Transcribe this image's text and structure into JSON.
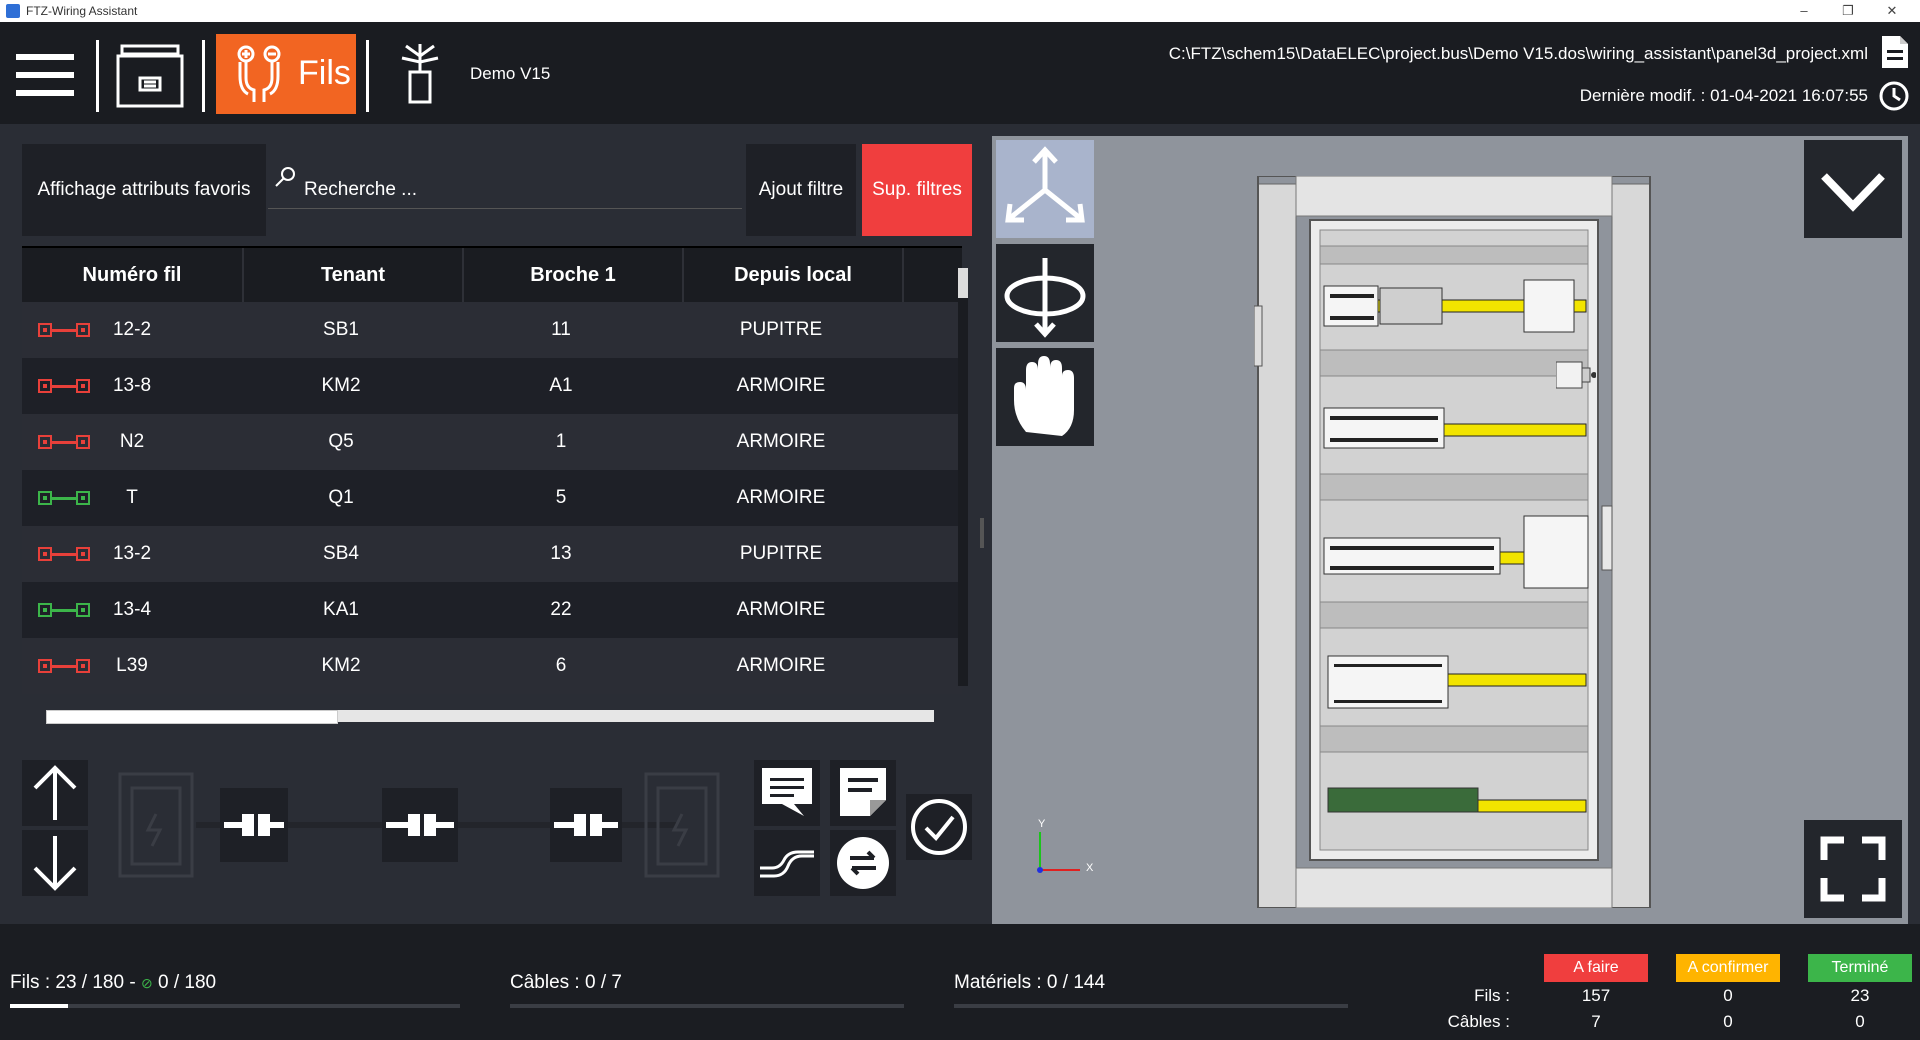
{
  "window": {
    "title": "FTZ-Wiring Assistant",
    "minimize": "–",
    "restore": "❐",
    "close": "✕"
  },
  "toolbar": {
    "fils_label": "Fils",
    "project_name": "Demo V15",
    "path": "C:\\FTZ\\schem15\\DataELEC\\project.bus\\Demo V15.dos\\wiring_assistant\\panel3d_project.xml",
    "last_modified": "Dernière modif. : 01-04-2021 16:07:55"
  },
  "filters": {
    "favorites_label": "Affichage attributs favoris",
    "search_placeholder": "Recherche ...",
    "add_filter_label": "Ajout filtre",
    "remove_filters_label": "Sup. filtres"
  },
  "table": {
    "columns": [
      "Numéro fil",
      "Tenant",
      "Broche 1",
      "Depuis local"
    ],
    "rows": [
      {
        "status": "red",
        "wire": "12-2",
        "tenant": "SB1",
        "broche": "11",
        "local": "PUPITRE"
      },
      {
        "status": "red",
        "wire": "13-8",
        "tenant": "KM2",
        "broche": "A1",
        "local": "ARMOIRE"
      },
      {
        "status": "red",
        "wire": "N2",
        "tenant": "Q5",
        "broche": "1",
        "local": "ARMOIRE"
      },
      {
        "status": "green",
        "wire": "T",
        "tenant": "Q1",
        "broche": "5",
        "local": "ARMOIRE"
      },
      {
        "status": "red",
        "wire": "13-2",
        "tenant": "SB4",
        "broche": "13",
        "local": "PUPITRE"
      },
      {
        "status": "green",
        "wire": "13-4",
        "tenant": "KA1",
        "broche": "22",
        "local": "ARMOIRE"
      },
      {
        "status": "red",
        "wire": "L39",
        "tenant": "KM2",
        "broche": "6",
        "local": "ARMOIRE"
      }
    ]
  },
  "viewport": {
    "axis_x": "X",
    "axis_y": "Y"
  },
  "status": {
    "fils_label": "Fils : 23 / 180 - ",
    "fils_done": "0 / 180",
    "fils_progress": 0.128,
    "cables_label": "Câbles : 0 / 7",
    "cables_progress": 0,
    "materiels_label": "Matériels : 0 / 144",
    "materiels_progress": 0,
    "badges": {
      "todo": "A faire",
      "confirm": "A confirmer",
      "done": "Terminé"
    },
    "row_fils": "Fils :",
    "row_cables": "Câbles :",
    "fils_counts": [
      "157",
      "0",
      "23"
    ],
    "cables_counts": [
      "7",
      "0",
      "0"
    ]
  },
  "colors": {
    "accent_orange": "#f26522",
    "red": "#f03e3e",
    "orange_badge": "#ffb400",
    "green_badge": "#3cb54a",
    "wire_red": "#e8403a",
    "wire_green": "#3cb54a"
  }
}
